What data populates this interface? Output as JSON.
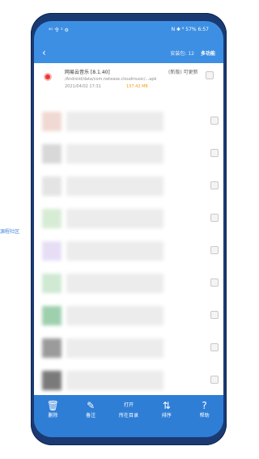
{
  "side_link": "源程社区",
  "status_bar": {
    "left": "⁴ᴳ 令 ³ ⚙",
    "right": "N ✱ ⁸ 57% 6:57"
  },
  "header": {
    "back": "‹",
    "info": "安装包: 12",
    "multi": "多功能"
  },
  "app": {
    "name": "网易云音乐 [8.1.40]",
    "path": "/Android/data/com.netease.cloudmusic/...apk",
    "date": "2021/04/02 17:31",
    "size": "137.42 MB",
    "status": "(新版) 可更新"
  },
  "bottom_bar": [
    {
      "icon": "🗑",
      "label": "删除"
    },
    {
      "icon": "✎",
      "label": "备注"
    },
    {
      "icon": "打开",
      "label": "所在目录"
    },
    {
      "icon": "⇅",
      "label": "排序"
    },
    {
      "icon": "?",
      "label": "帮助"
    }
  ]
}
